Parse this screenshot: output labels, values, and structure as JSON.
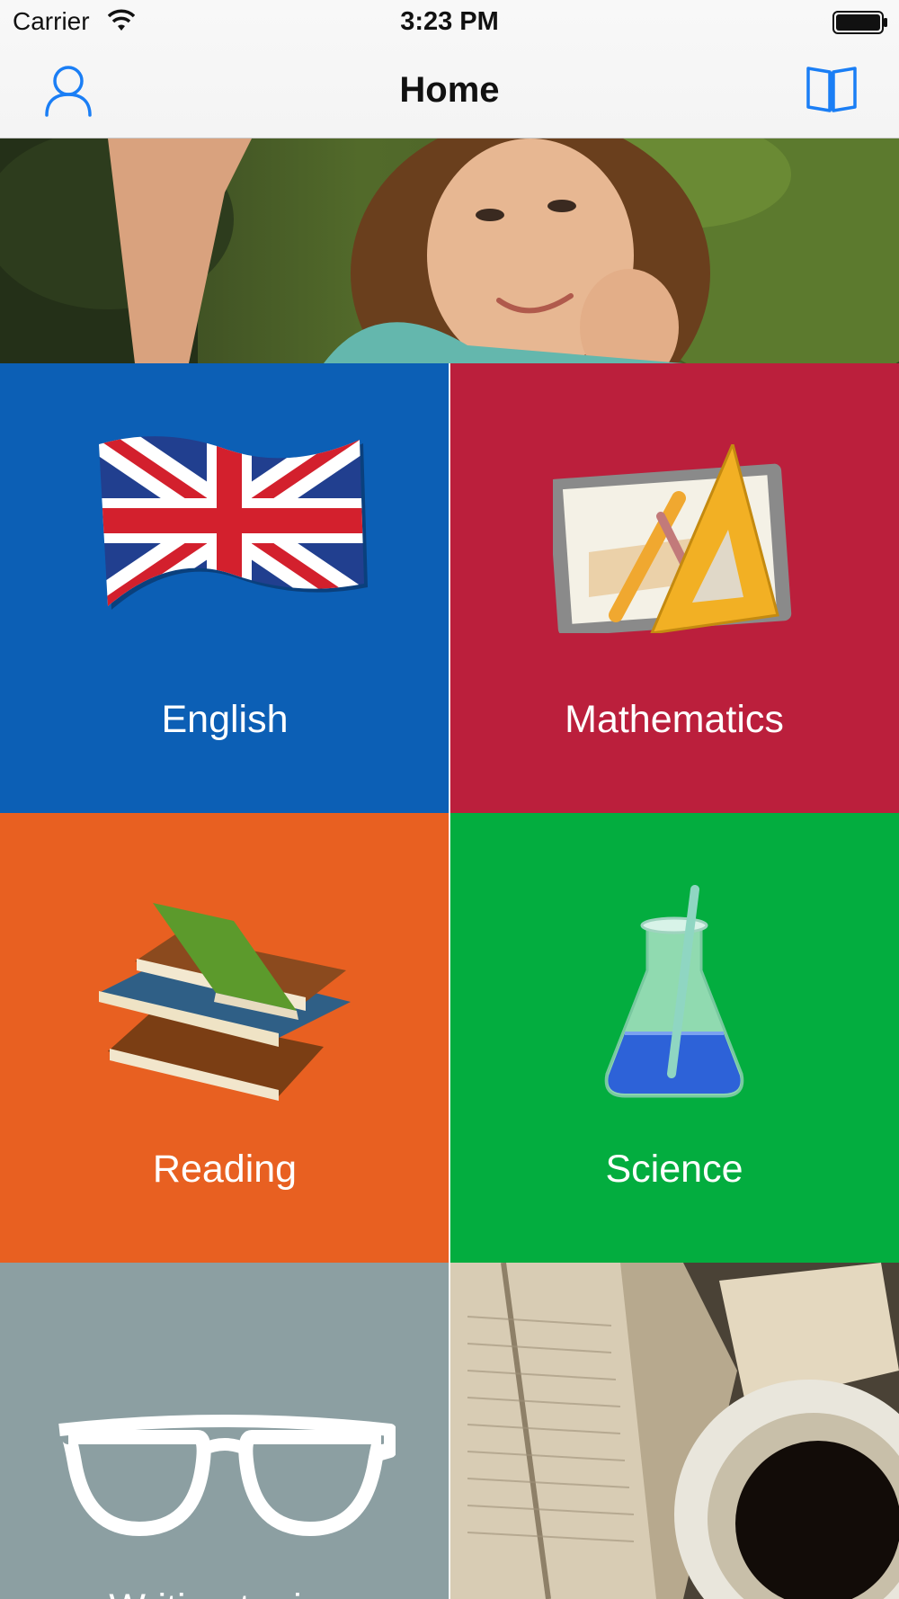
{
  "status_bar": {
    "carrier": "Carrier",
    "time": "3:23 PM",
    "wifi_icon": "wifi-icon",
    "battery_icon": "battery-icon"
  },
  "nav_bar": {
    "title": "Home",
    "left_icon": "person-icon",
    "right_icon": "book-icon",
    "accent_color": "#1a7ef5"
  },
  "banner": {
    "image": "student-with-laptop-photo"
  },
  "tiles": [
    {
      "label": "English",
      "icon": "uk-flag-icon",
      "color": "#0c5fb5"
    },
    {
      "label": "Mathematics",
      "icon": "geometry-tools-icon",
      "color": "#bb1f3c"
    },
    {
      "label": "Reading",
      "icon": "book-stack-icon",
      "color": "#e86021"
    },
    {
      "label": "Science",
      "icon": "flask-icon",
      "color": "#03ad3f"
    },
    {
      "label": "Writing topics",
      "icon": "glasses-icon",
      "color": "#8c9fa2"
    },
    {
      "label": "",
      "icon": "coffee-books-photo",
      "color": "#5e5548"
    }
  ]
}
